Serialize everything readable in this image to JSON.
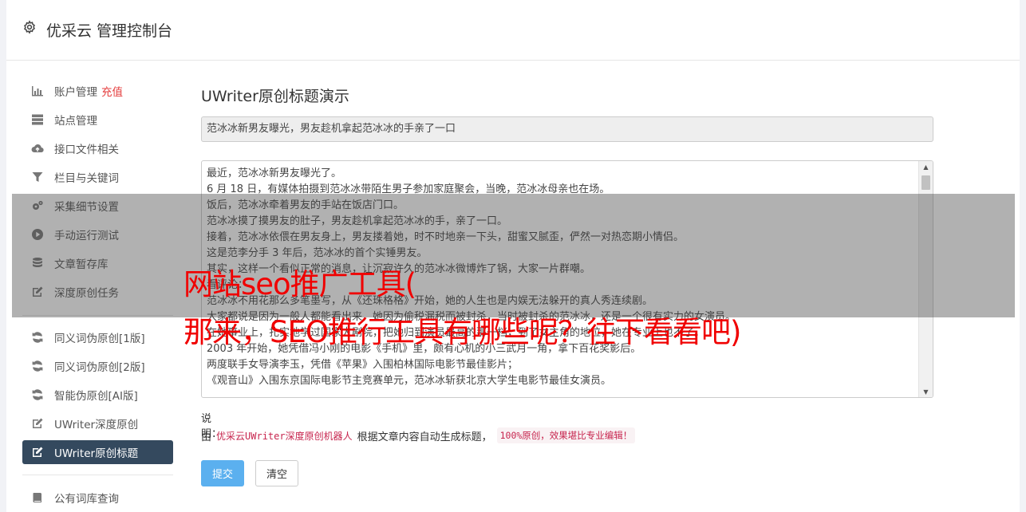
{
  "header": {
    "brand": "优采云 管理控制台",
    "icon": "gear-icon"
  },
  "sidebar": {
    "recharge_label": "充值",
    "items": [
      {
        "label": "账户管理",
        "icon": "bar-chart-icon"
      },
      {
        "label": "站点管理",
        "icon": "server-icon"
      },
      {
        "label": "接口文件相关",
        "icon": "cloud-upload-icon"
      },
      {
        "label": "栏目与关键词",
        "icon": "filter-icon"
      },
      {
        "label": "采集细节设置",
        "icon": "cogs-icon"
      },
      {
        "label": "手动运行测试",
        "icon": "play-circle-icon"
      },
      {
        "label": "文章暂存库",
        "icon": "database-icon"
      },
      {
        "label": "深度原创任务",
        "icon": "edit-icon"
      },
      {
        "label": "同义词伪原创[1版]",
        "icon": "refresh-icon"
      },
      {
        "label": "同义词伪原创[2版]",
        "icon": "refresh-icon"
      },
      {
        "label": "智能伪原创[AI版]",
        "icon": "refresh-icon"
      },
      {
        "label": "UWriter深度原创",
        "icon": "edit-icon"
      },
      {
        "label": "UWriter原创标题",
        "icon": "edit-icon",
        "active": true
      },
      {
        "label": "公有词库查询",
        "icon": "book-icon"
      }
    ]
  },
  "main": {
    "title": "UWriter原创标题演示",
    "title_input_value": "范冰冰新男友曝光，男友趁机拿起范冰冰的手亲了一口",
    "content_lines": [
      "最近，范冰冰新男友曝光了。",
      "6 月 18 日，有媒体拍摄到范冰冰带陌生男子参加家庭聚会，当晚，范冰冰母亲也在场。",
      "饭后，范冰冰牵着男友的手站在饭店门口。",
      "范冰冰摸了摸男友的肚子，男友趁机拿起范冰冰的手，亲了一口。",
      "接着，范冰冰依偎在男友身上，男友搂着她，时不时地亲一下头，甜蜜又腻歪，俨然一对热恋期小情侣。",
      "这是范李分手 3 年后，范冰冰的首个实锤男友。",
      "其实，这样一个看似正常的消息，让沉寂许久的范冰冰微博炸了锅，大家一片群嘲。",
      "看评论：",
      "范冰冰不用花那么多笔墨写，从《还珠格格》开始，她的人生也是内娱无法躲开的真人秀连续剧。",
      "大家都说是因为一般人都能看出来，她因为偷税漏税而被封杀，当时被封杀的范冰冰，还是一个很有实力的女演员。",
      "在她事业上，扎实地学过国家大剧院，把她归到演员最高的那一档，到了女主角的地位，她在专业上也不了。",
      "2003 年开始，她凭借冯小刚的电影《手机》里，颇有心机的小三武月一角，拿下百花奖影后。",
      "两度联手女导演李玉，凭借《苹果》入围柏林国际电影节最佳影片；",
      "《观音山》入围东京国际电影节主竞赛单元，范冰冰斩获北京大学生电影节最佳女演员。"
    ],
    "note_label": "说明：",
    "note_prefix": "由",
    "note_robot": "优采云UWriter深度原创机器人",
    "note_middle": "根据文章内容自动生成标题，",
    "note_badge": "100%原创，效果堪比专业编辑！",
    "submit_label": "提交",
    "clear_label": "清空"
  },
  "overlay": {
    "line1": "网站seo推广工具(",
    "line2": "那来，SEO推行工具有哪些呢？往下看看吧)"
  }
}
